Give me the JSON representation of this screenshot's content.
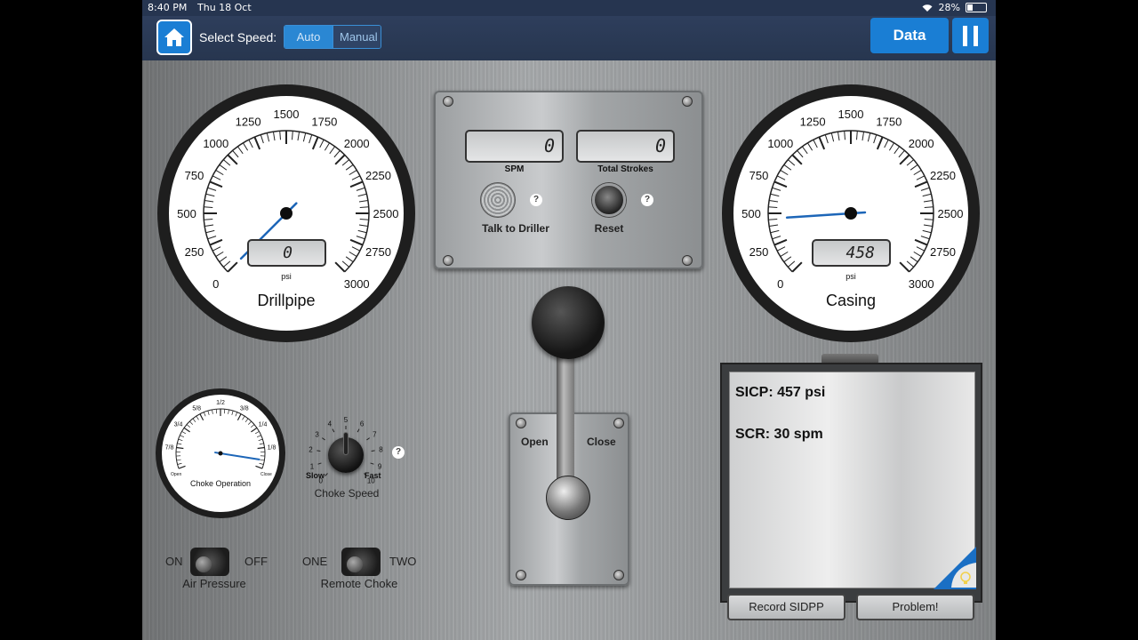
{
  "status_bar": {
    "time": "8:40 PM",
    "date": "Thu 18 Oct",
    "battery": "28%",
    "battery_level": 0.28
  },
  "top_bar": {
    "select_speed_label": "Select Speed:",
    "speed_options": [
      "Auto",
      "Manual"
    ],
    "selected_speed": "Auto",
    "data_button": "Data"
  },
  "drillpipe_gauge": {
    "title": "Drillpipe",
    "unit": "psi",
    "readout": "0",
    "value": 0,
    "range": [
      0,
      3000
    ],
    "tick_labels": [
      "0",
      "250",
      "500",
      "750",
      "1000",
      "1250",
      "1500",
      "1750",
      "2000",
      "2250",
      "2500",
      "2750",
      "3000"
    ]
  },
  "casing_gauge": {
    "title": "Casing",
    "unit": "psi",
    "readout": "458",
    "value": 458,
    "range": [
      0,
      3000
    ],
    "tick_labels": [
      "0",
      "250",
      "500",
      "750",
      "1000",
      "1250",
      "1500",
      "1750",
      "2000",
      "2250",
      "2500",
      "2750",
      "3000"
    ]
  },
  "pump_panel": {
    "spm_label": "SPM",
    "spm_readout": "0",
    "strokes_label": "Total Strokes",
    "strokes_readout": "0",
    "talk_label": "Talk to Driller",
    "reset_label": "Reset",
    "help": "?"
  },
  "choke_gauge": {
    "title": "Choke Operation",
    "open_label": "Open",
    "close_label": "Close",
    "tick_labels": [
      "7/8",
      "3/4",
      "5/8",
      "1/2",
      "3/8",
      "1/4",
      "1/8"
    ],
    "position": 0.95
  },
  "choke_speed": {
    "title": "Choke Speed",
    "slow_label": "Slow",
    "fast_label": "Fast",
    "numbers": [
      "0",
      "1",
      "2",
      "3",
      "4",
      "5",
      "6",
      "7",
      "8",
      "9",
      "10"
    ],
    "value": 5,
    "help": "?"
  },
  "air_pressure": {
    "title": "Air Pressure",
    "on_label": "ON",
    "off_label": "OFF"
  },
  "remote_choke": {
    "title": "Remote Choke",
    "one_label": "ONE",
    "two_label": "TWO"
  },
  "lever": {
    "open_label": "Open",
    "close_label": "Close"
  },
  "notes": {
    "line1": "SICP: 457 psi",
    "line2": "SCR: 30 spm",
    "record_button": "Record SIDPP",
    "problem_button": "Problem!"
  }
}
